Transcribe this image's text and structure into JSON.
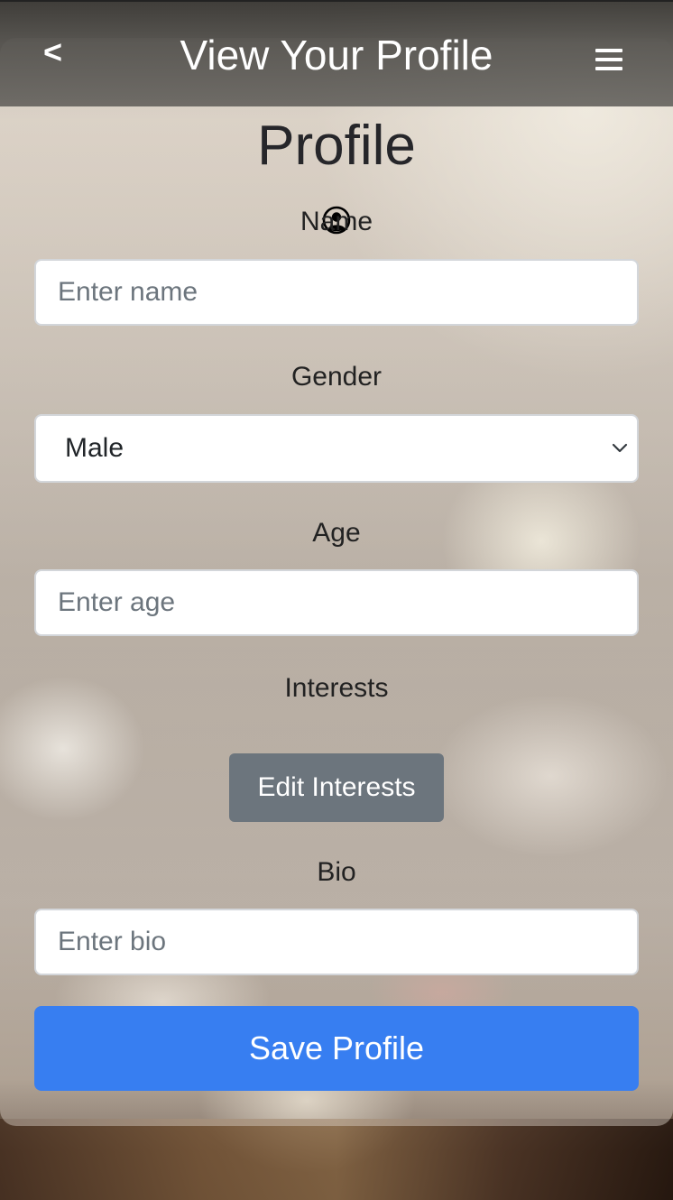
{
  "header": {
    "back_label": "<",
    "title": "View Your Profile"
  },
  "page": {
    "heading": "Profile",
    "avatar_icon": "user-circle-icon"
  },
  "form": {
    "name": {
      "label": "Name",
      "placeholder": "Enter name",
      "value": ""
    },
    "gender": {
      "label": "Gender",
      "selected": "Male"
    },
    "age": {
      "label": "Age",
      "placeholder": "Enter age",
      "value": ""
    },
    "interests": {
      "label": "Interests",
      "button_label": "Edit Interests"
    },
    "bio": {
      "label": "Bio",
      "placeholder": "Enter bio",
      "value": ""
    },
    "save_label": "Save Profile"
  },
  "colors": {
    "primary": "#377ef1",
    "secondary": "#6c757d",
    "text": "#222222"
  }
}
